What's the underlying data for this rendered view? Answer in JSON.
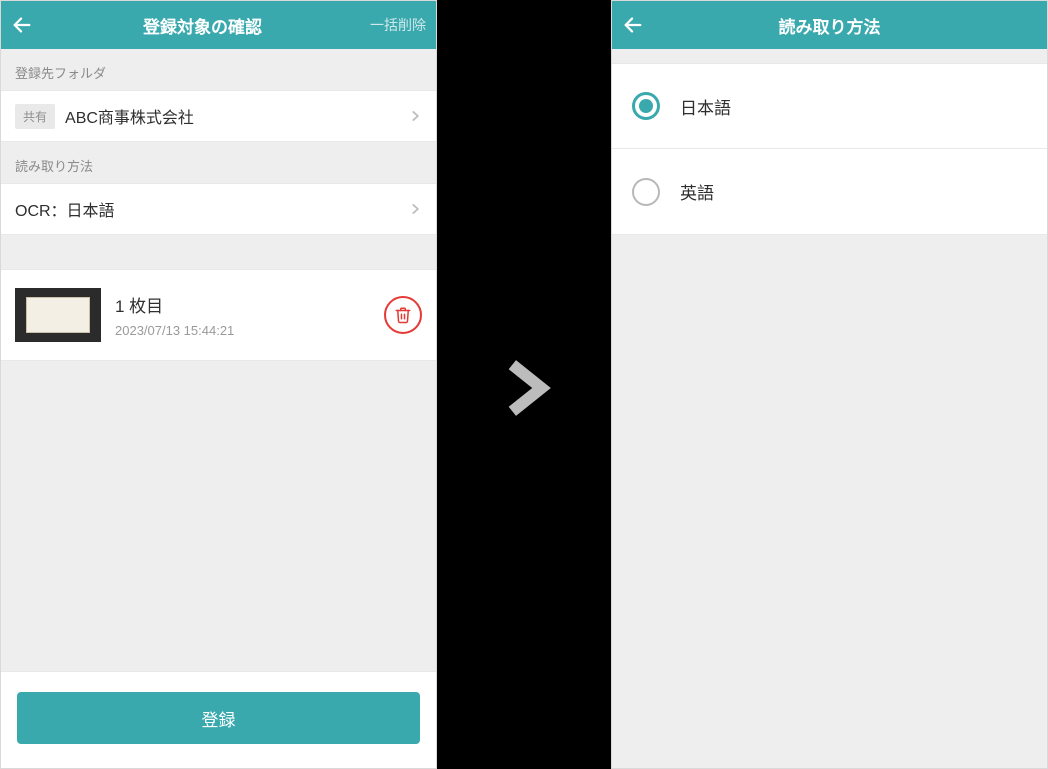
{
  "colors": {
    "accent": "#3aa9ae",
    "danger": "#e53935"
  },
  "left": {
    "title": "登録対象の確認",
    "bulk_delete": "一括削除",
    "folder_section_label": "登録先フォルダ",
    "folder_tag": "共有",
    "folder_name": "ABC商事株式会社",
    "method_section_label": "読み取り方法",
    "method_value": "OCR：日本語",
    "item": {
      "title": "1 枚目",
      "timestamp": "2023/07/13 15:44:21"
    },
    "register_button": "登録"
  },
  "right": {
    "title": "読み取り方法",
    "options": [
      {
        "label": "日本語",
        "selected": true
      },
      {
        "label": "英語",
        "selected": false
      }
    ]
  }
}
